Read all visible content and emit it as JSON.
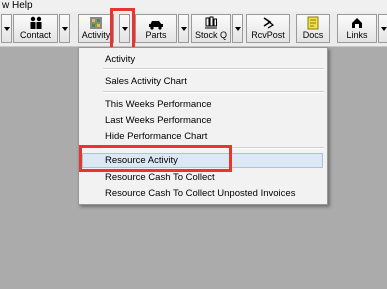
{
  "menubar": {
    "items": [
      "w",
      "Help"
    ]
  },
  "toolbar": {
    "buttons": [
      {
        "label": "Contact",
        "icon": "contact-icon"
      },
      {
        "label": "Activity",
        "icon": "activity-icon"
      },
      {
        "label": "Parts",
        "icon": "car-icon"
      },
      {
        "label": "Stock Q",
        "icon": "stock-icon"
      },
      {
        "label": "RcvPost",
        "icon": "receive-post-icon"
      },
      {
        "label": "Docs",
        "icon": "docs-icon"
      },
      {
        "label": "Links",
        "icon": "links-icon"
      }
    ]
  },
  "menu": {
    "items": [
      "Activity",
      "Sales Activity Chart",
      "This Weeks Performance",
      "Last Weeks Performance",
      "Hide Performance Chart",
      "Resource Activity",
      "Resource Cash To Collect",
      "Resource Cash To Collect Unposted Invoices"
    ],
    "selected": "Resource Activity"
  },
  "colors": {
    "highlight": "#e8352f",
    "background": "#ababab",
    "menu_hover": "#dde8f5"
  }
}
